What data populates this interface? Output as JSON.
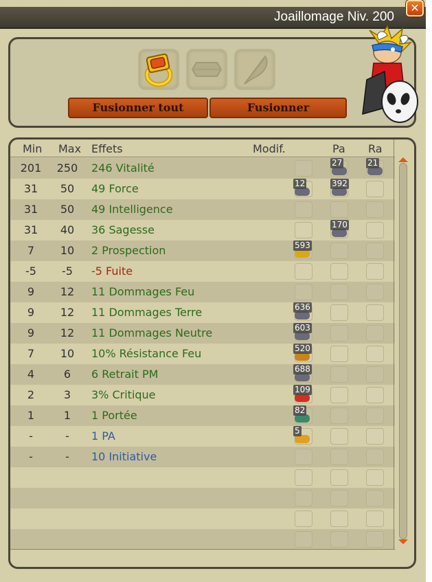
{
  "window": {
    "title": "Joaillomage Niv. 200",
    "close_label": "✕"
  },
  "slots": [
    {
      "icon": "gold-ring-icon"
    },
    {
      "icon": "rune-slot-icon"
    },
    {
      "icon": "feather-slot-icon"
    }
  ],
  "buttons": {
    "merge_all": "Fusionner tout",
    "merge": "Fusionner"
  },
  "table": {
    "headers": {
      "min": "Min",
      "max": "Max",
      "effects": "Effets",
      "modif": "Modif.",
      "pa": "Pa",
      "ra": "Ra"
    },
    "rows": [
      {
        "min": "201",
        "max": "250",
        "effect": "246 Vitalité",
        "color": "green",
        "pa": "27",
        "ra": "21"
      },
      {
        "min": "31",
        "max": "50",
        "effect": "49 Force",
        "color": "green",
        "mod": "12",
        "pa": "392"
      },
      {
        "min": "31",
        "max": "50",
        "effect": "49 Intelligence",
        "color": "green"
      },
      {
        "min": "31",
        "max": "40",
        "effect": "36 Sagesse",
        "color": "green",
        "pa": "170"
      },
      {
        "min": "7",
        "max": "10",
        "effect": "2 Prospection",
        "color": "green",
        "mod": "593"
      },
      {
        "min": "-5",
        "max": "-5",
        "effect": "-5 Fuite",
        "color": "red"
      },
      {
        "min": "9",
        "max": "12",
        "effect": "11 Dommages Feu",
        "color": "green"
      },
      {
        "min": "9",
        "max": "12",
        "effect": "11 Dommages Terre",
        "color": "green",
        "mod": "636"
      },
      {
        "min": "9",
        "max": "12",
        "effect": "11 Dommages Neutre",
        "color": "green",
        "mod": "603"
      },
      {
        "min": "7",
        "max": "10",
        "effect": "10% Résistance Feu",
        "color": "green",
        "mod": "520"
      },
      {
        "min": "4",
        "max": "6",
        "effect": "6 Retrait PM",
        "color": "green",
        "mod": "688"
      },
      {
        "min": "2",
        "max": "3",
        "effect": "3% Critique",
        "color": "green",
        "mod": "109"
      },
      {
        "min": "1",
        "max": "1",
        "effect": "1 Portée",
        "color": "green",
        "mod": "82"
      },
      {
        "min": "-",
        "max": "-",
        "effect": "1 PA",
        "color": "blue",
        "mod": "5"
      },
      {
        "min": "-",
        "max": "-",
        "effect": "10 Initiative",
        "color": "blue"
      },
      {},
      {},
      {},
      {}
    ]
  },
  "colors": {
    "green": "#2f6a1c",
    "red": "#a52a10",
    "blue": "#2f5aa8",
    "accent": "#e35a10"
  }
}
